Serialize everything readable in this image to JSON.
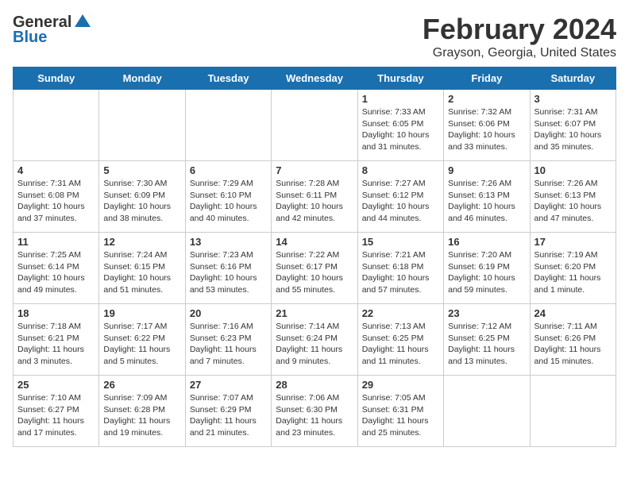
{
  "header": {
    "logo": {
      "general": "General",
      "blue": "Blue"
    },
    "title": "February 2024",
    "subtitle": "Grayson, Georgia, United States"
  },
  "weekdays": [
    "Sunday",
    "Monday",
    "Tuesday",
    "Wednesday",
    "Thursday",
    "Friday",
    "Saturday"
  ],
  "weeks": [
    [
      {
        "day": "",
        "sunrise": "",
        "sunset": "",
        "daylight": ""
      },
      {
        "day": "",
        "sunrise": "",
        "sunset": "",
        "daylight": ""
      },
      {
        "day": "",
        "sunrise": "",
        "sunset": "",
        "daylight": ""
      },
      {
        "day": "",
        "sunrise": "",
        "sunset": "",
        "daylight": ""
      },
      {
        "day": "1",
        "sunrise": "Sunrise: 7:33 AM",
        "sunset": "Sunset: 6:05 PM",
        "daylight": "Daylight: 10 hours and 31 minutes."
      },
      {
        "day": "2",
        "sunrise": "Sunrise: 7:32 AM",
        "sunset": "Sunset: 6:06 PM",
        "daylight": "Daylight: 10 hours and 33 minutes."
      },
      {
        "day": "3",
        "sunrise": "Sunrise: 7:31 AM",
        "sunset": "Sunset: 6:07 PM",
        "daylight": "Daylight: 10 hours and 35 minutes."
      }
    ],
    [
      {
        "day": "4",
        "sunrise": "Sunrise: 7:31 AM",
        "sunset": "Sunset: 6:08 PM",
        "daylight": "Daylight: 10 hours and 37 minutes."
      },
      {
        "day": "5",
        "sunrise": "Sunrise: 7:30 AM",
        "sunset": "Sunset: 6:09 PM",
        "daylight": "Daylight: 10 hours and 38 minutes."
      },
      {
        "day": "6",
        "sunrise": "Sunrise: 7:29 AM",
        "sunset": "Sunset: 6:10 PM",
        "daylight": "Daylight: 10 hours and 40 minutes."
      },
      {
        "day": "7",
        "sunrise": "Sunrise: 7:28 AM",
        "sunset": "Sunset: 6:11 PM",
        "daylight": "Daylight: 10 hours and 42 minutes."
      },
      {
        "day": "8",
        "sunrise": "Sunrise: 7:27 AM",
        "sunset": "Sunset: 6:12 PM",
        "daylight": "Daylight: 10 hours and 44 minutes."
      },
      {
        "day": "9",
        "sunrise": "Sunrise: 7:26 AM",
        "sunset": "Sunset: 6:13 PM",
        "daylight": "Daylight: 10 hours and 46 minutes."
      },
      {
        "day": "10",
        "sunrise": "Sunrise: 7:26 AM",
        "sunset": "Sunset: 6:13 PM",
        "daylight": "Daylight: 10 hours and 47 minutes."
      }
    ],
    [
      {
        "day": "11",
        "sunrise": "Sunrise: 7:25 AM",
        "sunset": "Sunset: 6:14 PM",
        "daylight": "Daylight: 10 hours and 49 minutes."
      },
      {
        "day": "12",
        "sunrise": "Sunrise: 7:24 AM",
        "sunset": "Sunset: 6:15 PM",
        "daylight": "Daylight: 10 hours and 51 minutes."
      },
      {
        "day": "13",
        "sunrise": "Sunrise: 7:23 AM",
        "sunset": "Sunset: 6:16 PM",
        "daylight": "Daylight: 10 hours and 53 minutes."
      },
      {
        "day": "14",
        "sunrise": "Sunrise: 7:22 AM",
        "sunset": "Sunset: 6:17 PM",
        "daylight": "Daylight: 10 hours and 55 minutes."
      },
      {
        "day": "15",
        "sunrise": "Sunrise: 7:21 AM",
        "sunset": "Sunset: 6:18 PM",
        "daylight": "Daylight: 10 hours and 57 minutes."
      },
      {
        "day": "16",
        "sunrise": "Sunrise: 7:20 AM",
        "sunset": "Sunset: 6:19 PM",
        "daylight": "Daylight: 10 hours and 59 minutes."
      },
      {
        "day": "17",
        "sunrise": "Sunrise: 7:19 AM",
        "sunset": "Sunset: 6:20 PM",
        "daylight": "Daylight: 11 hours and 1 minute."
      }
    ],
    [
      {
        "day": "18",
        "sunrise": "Sunrise: 7:18 AM",
        "sunset": "Sunset: 6:21 PM",
        "daylight": "Daylight: 11 hours and 3 minutes."
      },
      {
        "day": "19",
        "sunrise": "Sunrise: 7:17 AM",
        "sunset": "Sunset: 6:22 PM",
        "daylight": "Daylight: 11 hours and 5 minutes."
      },
      {
        "day": "20",
        "sunrise": "Sunrise: 7:16 AM",
        "sunset": "Sunset: 6:23 PM",
        "daylight": "Daylight: 11 hours and 7 minutes."
      },
      {
        "day": "21",
        "sunrise": "Sunrise: 7:14 AM",
        "sunset": "Sunset: 6:24 PM",
        "daylight": "Daylight: 11 hours and 9 minutes."
      },
      {
        "day": "22",
        "sunrise": "Sunrise: 7:13 AM",
        "sunset": "Sunset: 6:25 PM",
        "daylight": "Daylight: 11 hours and 11 minutes."
      },
      {
        "day": "23",
        "sunrise": "Sunrise: 7:12 AM",
        "sunset": "Sunset: 6:25 PM",
        "daylight": "Daylight: 11 hours and 13 minutes."
      },
      {
        "day": "24",
        "sunrise": "Sunrise: 7:11 AM",
        "sunset": "Sunset: 6:26 PM",
        "daylight": "Daylight: 11 hours and 15 minutes."
      }
    ],
    [
      {
        "day": "25",
        "sunrise": "Sunrise: 7:10 AM",
        "sunset": "Sunset: 6:27 PM",
        "daylight": "Daylight: 11 hours and 17 minutes."
      },
      {
        "day": "26",
        "sunrise": "Sunrise: 7:09 AM",
        "sunset": "Sunset: 6:28 PM",
        "daylight": "Daylight: 11 hours and 19 minutes."
      },
      {
        "day": "27",
        "sunrise": "Sunrise: 7:07 AM",
        "sunset": "Sunset: 6:29 PM",
        "daylight": "Daylight: 11 hours and 21 minutes."
      },
      {
        "day": "28",
        "sunrise": "Sunrise: 7:06 AM",
        "sunset": "Sunset: 6:30 PM",
        "daylight": "Daylight: 11 hours and 23 minutes."
      },
      {
        "day": "29",
        "sunrise": "Sunrise: 7:05 AM",
        "sunset": "Sunset: 6:31 PM",
        "daylight": "Daylight: 11 hours and 25 minutes."
      },
      {
        "day": "",
        "sunrise": "",
        "sunset": "",
        "daylight": ""
      },
      {
        "day": "",
        "sunrise": "",
        "sunset": "",
        "daylight": ""
      }
    ]
  ]
}
